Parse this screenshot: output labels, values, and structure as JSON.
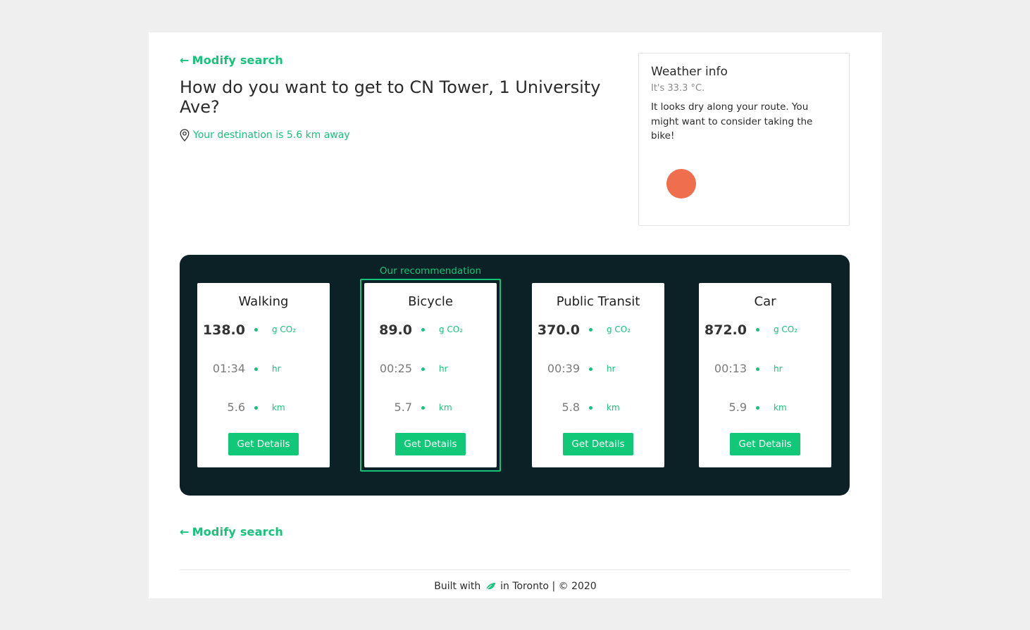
{
  "nav": {
    "modify_label": "Modify search",
    "arrow": "←"
  },
  "header": {
    "title": "How do you want to get to CN Tower, 1 University Ave?",
    "distance_text": "Your destination is 5.6 km away",
    "location_icon": "map-pin-icon"
  },
  "weather": {
    "heading": "Weather info",
    "temperature": "It's 33.3 °C.",
    "message": "It looks dry along your route. You might want to consider taking the bike!",
    "sun_color": "#ee6e4e"
  },
  "recommendation_label": "Our recommendation",
  "units": {
    "co2": "g CO₂",
    "time": "hr",
    "distance": "km"
  },
  "options": [
    {
      "name": "Walking",
      "co2": "138.0",
      "time": "01:34",
      "distance": "5.6",
      "button": "Get Details",
      "recommended": false
    },
    {
      "name": "Bicycle",
      "co2": "89.0",
      "time": "00:25",
      "distance": "5.7",
      "button": "Get Details",
      "recommended": true
    },
    {
      "name": "Public Transit",
      "co2": "370.0",
      "time": "00:39",
      "distance": "5.8",
      "button": "Get Details",
      "recommended": false
    },
    {
      "name": "Car",
      "co2": "872.0",
      "time": "00:13",
      "distance": "5.9",
      "button": "Get Details",
      "recommended": false
    }
  ],
  "footer": {
    "prefix": "Built with",
    "suffix": "in Toronto | © 2020",
    "icon": "leaf-icon"
  },
  "colors": {
    "accent": "#17c27a",
    "panel": "#0c2126",
    "button": "#10c877"
  }
}
